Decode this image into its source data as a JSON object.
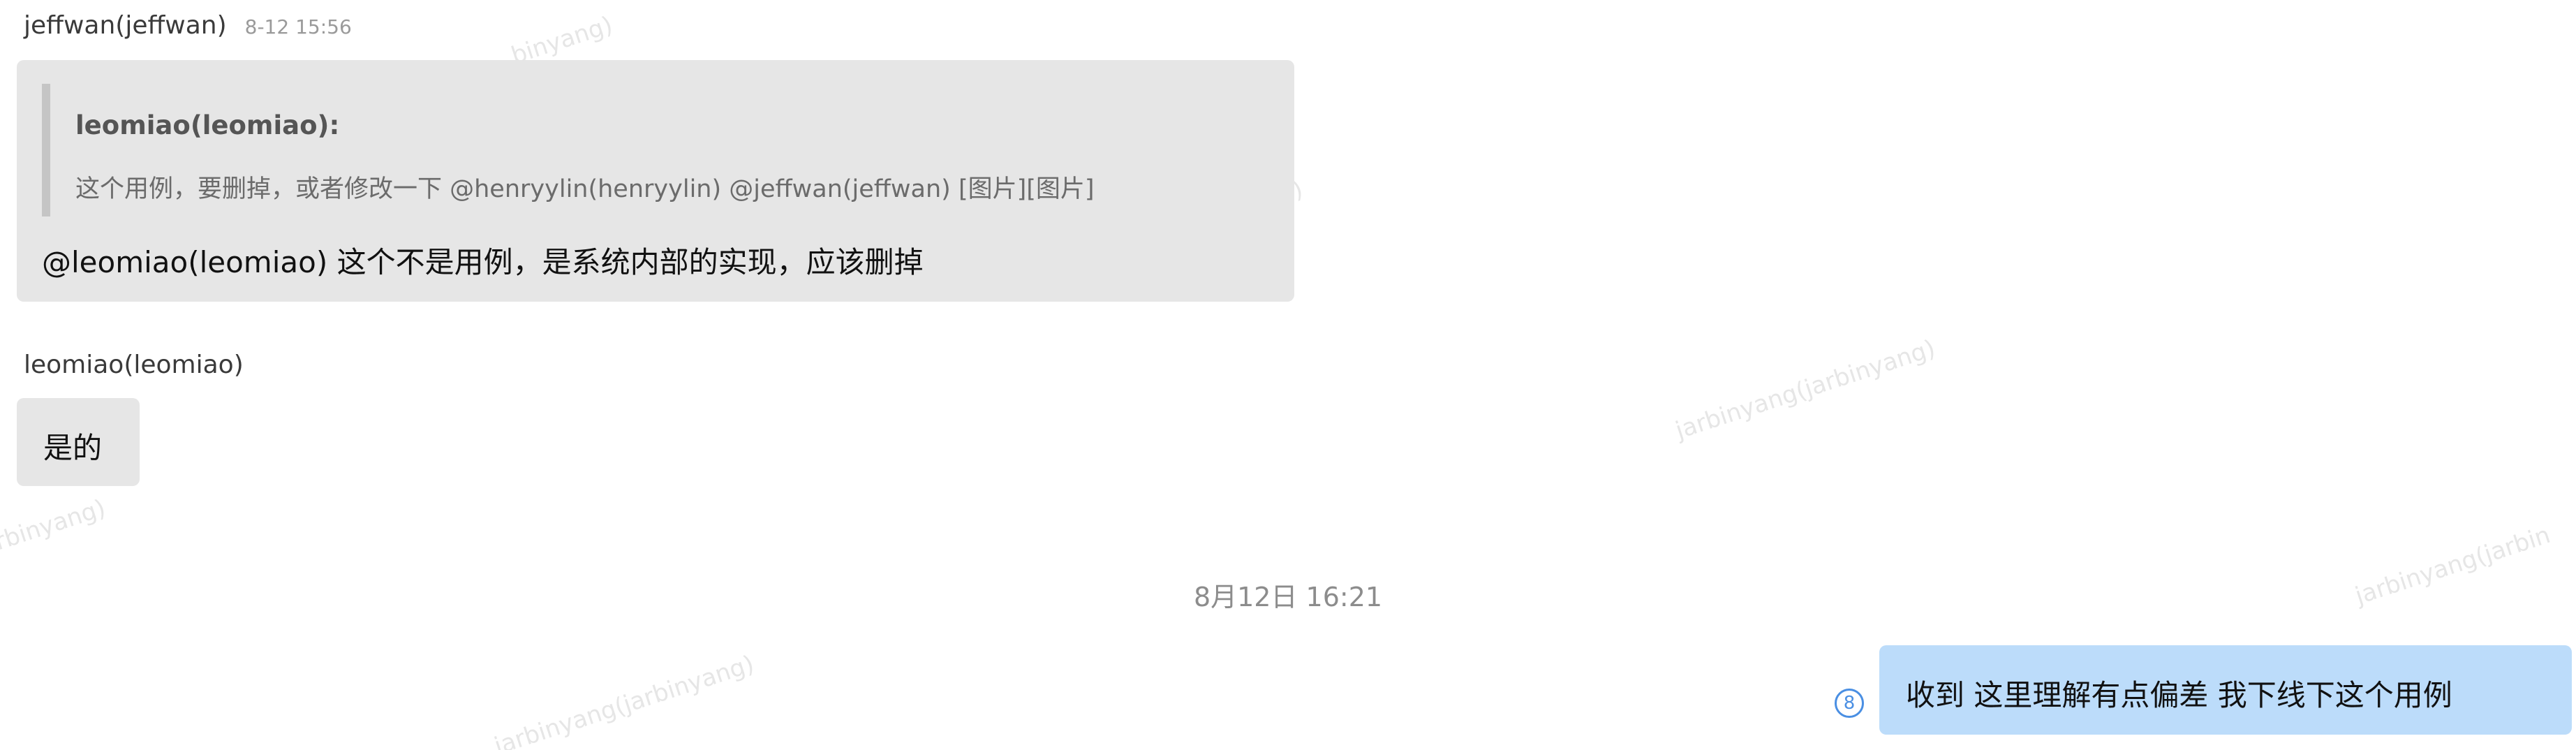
{
  "watermark": {
    "text": "jarbinyang(jarbinyang)",
    "fragments": [
      "binyang)",
      ")",
      "rbinyang)",
      "jarbinyang(jarbin"
    ]
  },
  "messages": [
    {
      "sender": "jeffwan(jeffwan)",
      "time": "8-12 15:56",
      "quote": {
        "author": "leomiao(leomiao):",
        "text": "这个用例，要删掉，或者修改一下 @henryylin(henryylin) @jeffwan(jeffwan) [图片][图片]"
      },
      "text": "@leomiao(leomiao) 这个不是用例，是系统内部的实现，应该删掉"
    },
    {
      "sender": "leomiao(leomiao)",
      "text": "是的"
    }
  ],
  "divider": {
    "time": "8月12日 16:21"
  },
  "my_message": {
    "text": "收到 这里理解有点偏差 我下线下这个用例",
    "read_icon_label": "8",
    "icon": "read-count-icon"
  },
  "colors": {
    "bubble_gray": "#e6e6e6",
    "bubble_blue": "#bcdcfa",
    "read_icon": "#4a8fe3"
  }
}
